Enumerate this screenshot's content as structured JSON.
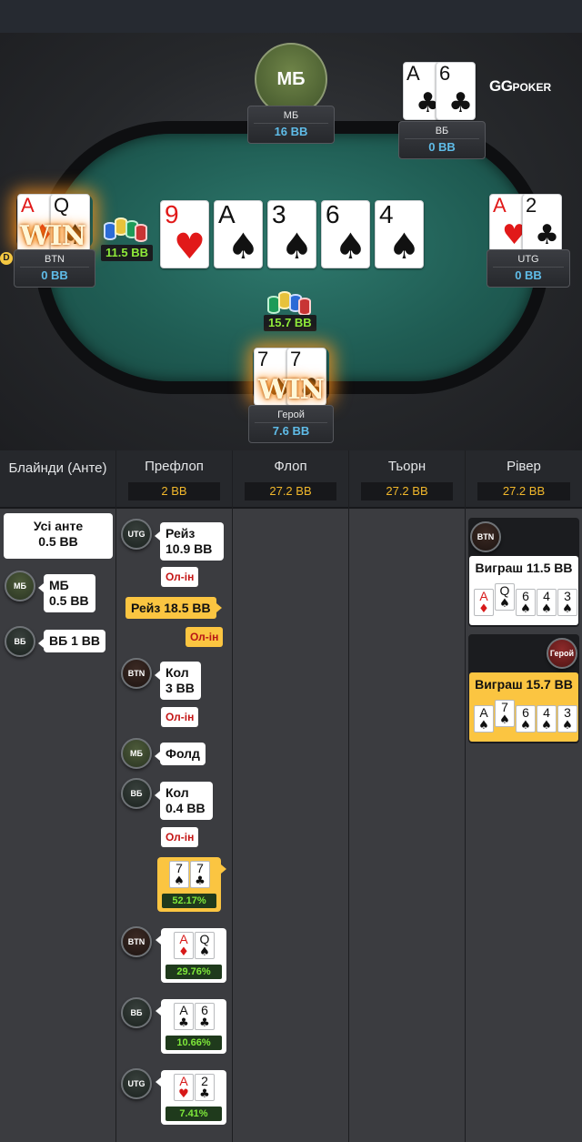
{
  "brand": {
    "logo_main": "GG",
    "logo_sub": "POKER"
  },
  "table": {
    "board": [
      {
        "rank": "9",
        "suit": "♥",
        "color": "red"
      },
      {
        "rank": "A",
        "suit": "♠",
        "color": "black"
      },
      {
        "rank": "3",
        "suit": "♠",
        "color": "black"
      },
      {
        "rank": "6",
        "suit": "♠",
        "color": "black"
      },
      {
        "rank": "4",
        "suit": "♠",
        "color": "black"
      }
    ],
    "pot": "15.7 BB",
    "seats": {
      "sb": {
        "avatar_label": "МБ",
        "name": "МБ",
        "stack": "16 BB"
      },
      "bb": {
        "name": "ВБ",
        "stack": "0 BB",
        "cards": [
          {
            "rank": "A",
            "suit": "♣",
            "color": "black"
          },
          {
            "rank": "6",
            "suit": "♣",
            "color": "black"
          }
        ]
      },
      "btn": {
        "name": "BTN",
        "stack": "0 BB",
        "bet": "11.5 BB",
        "win_label": "WIN",
        "dealer_label": "D",
        "cards": [
          {
            "rank": "A",
            "suit": "♦",
            "color": "red"
          },
          {
            "rank": "Q",
            "suit": "♠",
            "color": "black"
          }
        ]
      },
      "utg": {
        "name": "UTG",
        "stack": "0 BB",
        "cards": [
          {
            "rank": "A",
            "suit": "♥",
            "color": "red"
          },
          {
            "rank": "2",
            "suit": "♣",
            "color": "black"
          }
        ]
      },
      "hero": {
        "name": "Герой",
        "stack": "7.6 BB",
        "win_label": "WIN",
        "cards": [
          {
            "rank": "7",
            "suit": "♠",
            "color": "black"
          },
          {
            "rank": "7",
            "suit": "♣",
            "color": "black"
          }
        ]
      }
    }
  },
  "history": {
    "columns": [
      {
        "title": "Блайнди (Анте)",
        "pot": ""
      },
      {
        "title": "Префлоп",
        "pot": "2 BB"
      },
      {
        "title": "Флоп",
        "pot": "27.2 BB"
      },
      {
        "title": "Тьорн",
        "pot": "27.2 BB"
      },
      {
        "title": "Рівер",
        "pot": "27.2 BB"
      }
    ],
    "blinds": {
      "ante_line1": "Усі анте",
      "ante_line2": "0.5 BB",
      "sb_badge": "МБ",
      "sb_line1": "МБ",
      "sb_line2": "0.5 BB",
      "bb_badge": "ВБ",
      "bb_text": "ВБ 1 BB"
    },
    "preflop": {
      "utg_badge": "UTG",
      "utg_line1": "Рейз",
      "utg_line2": "10.9 BB",
      "utg_allin": "Ол-ін",
      "hero_raise": "Рейз 18.5 BB",
      "hero_allin": "Ол-ін",
      "btn_badge": "BTN",
      "btn_line1": "Кол",
      "btn_line2": "3 BB",
      "btn_allin": "Ол-ін",
      "sb_badge": "МБ",
      "sb_fold": "Фолд",
      "bb_badge": "ВБ",
      "bb_line1": "Кол",
      "bb_line2": "0.4 BB",
      "bb_allin": "Ол-ін",
      "showdowns": [
        {
          "badge": "",
          "equity": "52.17%",
          "cards": [
            {
              "rank": "7",
              "suit": "♠",
              "color": "black"
            },
            {
              "rank": "7",
              "suit": "♣",
              "color": "black"
            }
          ]
        },
        {
          "badge": "BTN",
          "equity": "29.76%",
          "cards": [
            {
              "rank": "A",
              "suit": "♦",
              "color": "red"
            },
            {
              "rank": "Q",
              "suit": "♠",
              "color": "black"
            }
          ]
        },
        {
          "badge": "ВБ",
          "equity": "10.66%",
          "cards": [
            {
              "rank": "A",
              "suit": "♣",
              "color": "black"
            },
            {
              "rank": "6",
              "suit": "♣",
              "color": "black"
            }
          ]
        },
        {
          "badge": "UTG",
          "equity": "7.41%",
          "cards": [
            {
              "rank": "A",
              "suit": "♥",
              "color": "red"
            },
            {
              "rank": "2",
              "suit": "♣",
              "color": "black"
            }
          ]
        }
      ]
    },
    "river": {
      "btn_badge": "BTN",
      "btn_text": "Виграш 11.5 BB",
      "btn_hand": [
        {
          "rank": "A",
          "suit": "♦",
          "color": "red"
        },
        {
          "rank": "Q",
          "suit": "♠",
          "color": "black"
        },
        {
          "rank": "6",
          "suit": "♠",
          "color": "black"
        },
        {
          "rank": "4",
          "suit": "♠",
          "color": "black"
        },
        {
          "rank": "3",
          "suit": "♠",
          "color": "black"
        }
      ],
      "hero_badge": "Герой",
      "hero_text": "Виграш 15.7 BB",
      "hero_hand": [
        {
          "rank": "A",
          "suit": "♠",
          "color": "black"
        },
        {
          "rank": "7",
          "suit": "♠",
          "color": "black"
        },
        {
          "rank": "6",
          "suit": "♠",
          "color": "black"
        },
        {
          "rank": "4",
          "suit": "♠",
          "color": "black"
        },
        {
          "rank": "3",
          "suit": "♠",
          "color": "black"
        }
      ]
    }
  },
  "colors": {
    "accent_gold": "#fbc541",
    "stack_blue": "#5fbce8",
    "felt": "#1f5c53",
    "equity_green": "#7ee83a",
    "allin_red": "#c41515"
  }
}
